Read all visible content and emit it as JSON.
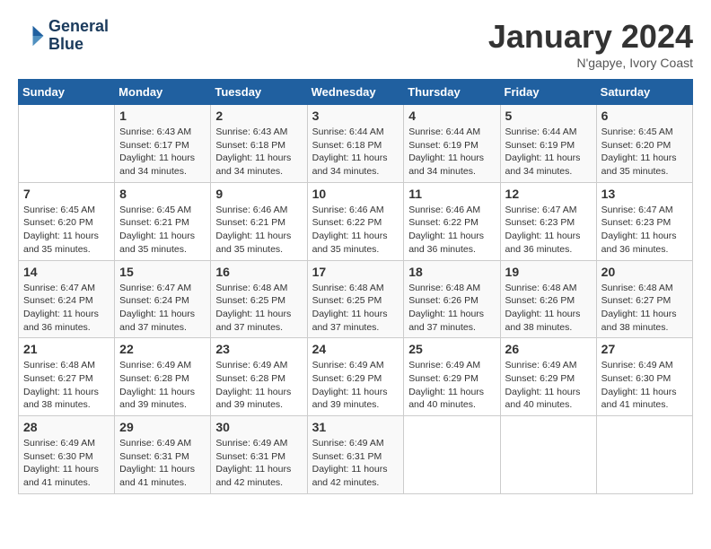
{
  "header": {
    "logo_line1": "General",
    "logo_line2": "Blue",
    "month": "January 2024",
    "location": "N'gapye, Ivory Coast"
  },
  "weekdays": [
    "Sunday",
    "Monday",
    "Tuesday",
    "Wednesday",
    "Thursday",
    "Friday",
    "Saturday"
  ],
  "weeks": [
    [
      {
        "day": "",
        "info": ""
      },
      {
        "day": "1",
        "info": "Sunrise: 6:43 AM\nSunset: 6:17 PM\nDaylight: 11 hours\nand 34 minutes."
      },
      {
        "day": "2",
        "info": "Sunrise: 6:43 AM\nSunset: 6:18 PM\nDaylight: 11 hours\nand 34 minutes."
      },
      {
        "day": "3",
        "info": "Sunrise: 6:44 AM\nSunset: 6:18 PM\nDaylight: 11 hours\nand 34 minutes."
      },
      {
        "day": "4",
        "info": "Sunrise: 6:44 AM\nSunset: 6:19 PM\nDaylight: 11 hours\nand 34 minutes."
      },
      {
        "day": "5",
        "info": "Sunrise: 6:44 AM\nSunset: 6:19 PM\nDaylight: 11 hours\nand 34 minutes."
      },
      {
        "day": "6",
        "info": "Sunrise: 6:45 AM\nSunset: 6:20 PM\nDaylight: 11 hours\nand 35 minutes."
      }
    ],
    [
      {
        "day": "7",
        "info": "Sunrise: 6:45 AM\nSunset: 6:20 PM\nDaylight: 11 hours\nand 35 minutes."
      },
      {
        "day": "8",
        "info": "Sunrise: 6:45 AM\nSunset: 6:21 PM\nDaylight: 11 hours\nand 35 minutes."
      },
      {
        "day": "9",
        "info": "Sunrise: 6:46 AM\nSunset: 6:21 PM\nDaylight: 11 hours\nand 35 minutes."
      },
      {
        "day": "10",
        "info": "Sunrise: 6:46 AM\nSunset: 6:22 PM\nDaylight: 11 hours\nand 35 minutes."
      },
      {
        "day": "11",
        "info": "Sunrise: 6:46 AM\nSunset: 6:22 PM\nDaylight: 11 hours\nand 36 minutes."
      },
      {
        "day": "12",
        "info": "Sunrise: 6:47 AM\nSunset: 6:23 PM\nDaylight: 11 hours\nand 36 minutes."
      },
      {
        "day": "13",
        "info": "Sunrise: 6:47 AM\nSunset: 6:23 PM\nDaylight: 11 hours\nand 36 minutes."
      }
    ],
    [
      {
        "day": "14",
        "info": "Sunrise: 6:47 AM\nSunset: 6:24 PM\nDaylight: 11 hours\nand 36 minutes."
      },
      {
        "day": "15",
        "info": "Sunrise: 6:47 AM\nSunset: 6:24 PM\nDaylight: 11 hours\nand 37 minutes."
      },
      {
        "day": "16",
        "info": "Sunrise: 6:48 AM\nSunset: 6:25 PM\nDaylight: 11 hours\nand 37 minutes."
      },
      {
        "day": "17",
        "info": "Sunrise: 6:48 AM\nSunset: 6:25 PM\nDaylight: 11 hours\nand 37 minutes."
      },
      {
        "day": "18",
        "info": "Sunrise: 6:48 AM\nSunset: 6:26 PM\nDaylight: 11 hours\nand 37 minutes."
      },
      {
        "day": "19",
        "info": "Sunrise: 6:48 AM\nSunset: 6:26 PM\nDaylight: 11 hours\nand 38 minutes."
      },
      {
        "day": "20",
        "info": "Sunrise: 6:48 AM\nSunset: 6:27 PM\nDaylight: 11 hours\nand 38 minutes."
      }
    ],
    [
      {
        "day": "21",
        "info": "Sunrise: 6:48 AM\nSunset: 6:27 PM\nDaylight: 11 hours\nand 38 minutes."
      },
      {
        "day": "22",
        "info": "Sunrise: 6:49 AM\nSunset: 6:28 PM\nDaylight: 11 hours\nand 39 minutes."
      },
      {
        "day": "23",
        "info": "Sunrise: 6:49 AM\nSunset: 6:28 PM\nDaylight: 11 hours\nand 39 minutes."
      },
      {
        "day": "24",
        "info": "Sunrise: 6:49 AM\nSunset: 6:29 PM\nDaylight: 11 hours\nand 39 minutes."
      },
      {
        "day": "25",
        "info": "Sunrise: 6:49 AM\nSunset: 6:29 PM\nDaylight: 11 hours\nand 40 minutes."
      },
      {
        "day": "26",
        "info": "Sunrise: 6:49 AM\nSunset: 6:29 PM\nDaylight: 11 hours\nand 40 minutes."
      },
      {
        "day": "27",
        "info": "Sunrise: 6:49 AM\nSunset: 6:30 PM\nDaylight: 11 hours\nand 41 minutes."
      }
    ],
    [
      {
        "day": "28",
        "info": "Sunrise: 6:49 AM\nSunset: 6:30 PM\nDaylight: 11 hours\nand 41 minutes."
      },
      {
        "day": "29",
        "info": "Sunrise: 6:49 AM\nSunset: 6:31 PM\nDaylight: 11 hours\nand 41 minutes."
      },
      {
        "day": "30",
        "info": "Sunrise: 6:49 AM\nSunset: 6:31 PM\nDaylight: 11 hours\nand 42 minutes."
      },
      {
        "day": "31",
        "info": "Sunrise: 6:49 AM\nSunset: 6:31 PM\nDaylight: 11 hours\nand 42 minutes."
      },
      {
        "day": "",
        "info": ""
      },
      {
        "day": "",
        "info": ""
      },
      {
        "day": "",
        "info": ""
      }
    ]
  ]
}
